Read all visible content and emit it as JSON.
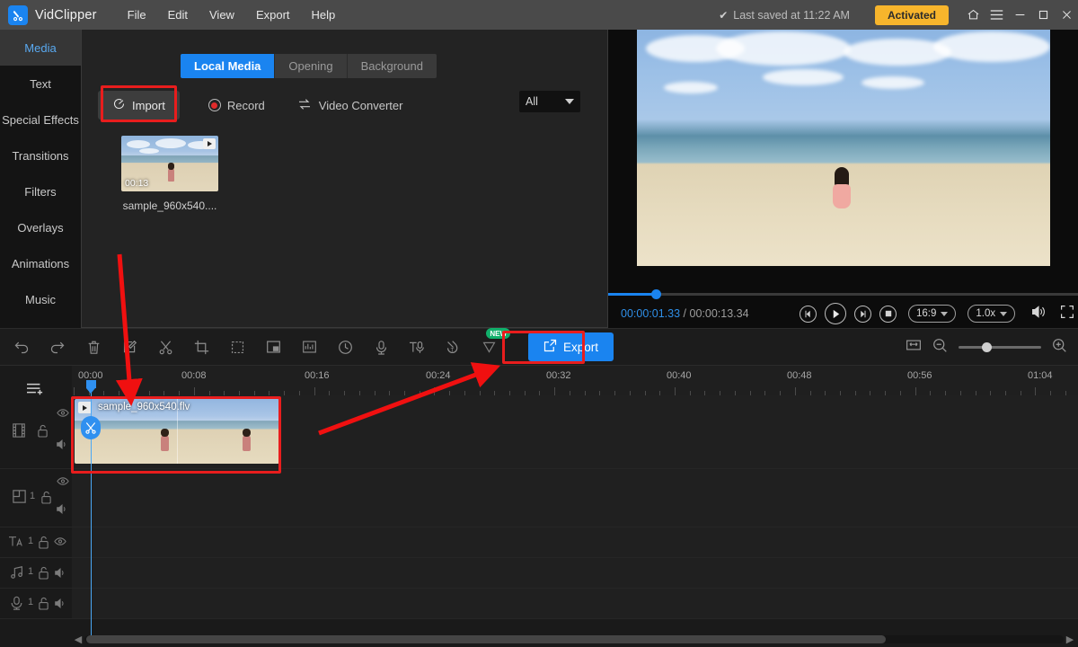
{
  "titlebar": {
    "app_name": "VidClipper",
    "logo_icon": "scissors-logo-icon",
    "menus": [
      "File",
      "Edit",
      "View",
      "Export",
      "Help"
    ],
    "saved_status": "Last saved at 11:22 AM",
    "check_icon": "check-icon",
    "license_badge": "Activated",
    "home_icon": "home-icon",
    "hamburger_icon": "hamburger-icon",
    "minimize_icon": "minimize-icon",
    "maximize_icon": "maximize-icon",
    "close_icon": "close-icon",
    "accent_color": "#1a84f0",
    "badge_color": "#f7b52c"
  },
  "sidebar": {
    "items": [
      {
        "label": "Media",
        "active": true
      },
      {
        "label": "Text",
        "active": false
      },
      {
        "label": "Special Effects",
        "active": false
      },
      {
        "label": "Transitions",
        "active": false
      },
      {
        "label": "Filters",
        "active": false
      },
      {
        "label": "Overlays",
        "active": false
      },
      {
        "label": "Animations",
        "active": false
      },
      {
        "label": "Music",
        "active": false
      }
    ]
  },
  "media_panel": {
    "tabs": [
      {
        "label": "Local Media",
        "active": true
      },
      {
        "label": "Opening",
        "active": false
      },
      {
        "label": "Background",
        "active": false
      }
    ],
    "import_label": "Import",
    "import_icon": "import-circle-arrow-icon",
    "record_label": "Record",
    "record_icon": "record-dot-icon",
    "converter_label": "Video Converter",
    "converter_icon": "convert-arrows-icon",
    "filter_value": "All",
    "filter_caret_icon": "chevron-down-icon",
    "assets": [
      {
        "name": "sample_960x540....",
        "duration": "00:13",
        "type_icon": "video-play-icon"
      }
    ]
  },
  "preview": {
    "current_time": "00:00:01.33",
    "separator": "/",
    "total_time": "00:00:13.34",
    "progress_percent": 10,
    "controls": [
      {
        "name": "previous-frame",
        "icon": "step-back-icon"
      },
      {
        "name": "play",
        "icon": "play-icon"
      },
      {
        "name": "next-frame",
        "icon": "step-forward-icon"
      },
      {
        "name": "stop",
        "icon": "stop-icon"
      }
    ],
    "aspect_ratio": "16:9",
    "playback_speed": "1.0x",
    "volume_icon": "speaker-icon",
    "fullscreen_icon": "fullscreen-icon"
  },
  "toolbar": {
    "icons": [
      {
        "name": "undo-icon",
        "glyph": "↶"
      },
      {
        "name": "redo-icon",
        "glyph": "↷"
      },
      {
        "name": "delete-icon",
        "glyph": "Ὕ1"
      },
      {
        "name": "edit-icon",
        "glyph": "✎"
      },
      {
        "name": "split-icon",
        "glyph": "✂"
      },
      {
        "name": "crop-icon",
        "glyph": "⌑"
      },
      {
        "name": "duplicate-icon",
        "glyph": "⧉"
      },
      {
        "name": "picture-in-picture-icon",
        "glyph": "▣"
      },
      {
        "name": "audio-waveform-icon",
        "glyph": "▐"
      },
      {
        "name": "speed-clock-icon",
        "glyph": "◴"
      },
      {
        "name": "microphone-icon",
        "glyph": "Ἲ4"
      },
      {
        "name": "text-to-speech-icon",
        "glyph": "T"
      },
      {
        "name": "watermark-icon",
        "glyph": "὘b"
      },
      {
        "name": "ai-tools-icon",
        "glyph": "✧",
        "badge": "NEW"
      }
    ],
    "export_label": "Export",
    "export_icon": "export-share-icon",
    "fit-timeline_icon": "fit-timeline-icon",
    "zoom_out_icon": "zoom-out-icon",
    "zoom_in_icon": "zoom-in-icon",
    "zoom_level_percent": 30
  },
  "timeline": {
    "add_track_icon": "add-track-icon",
    "ruler_labels": [
      "00:00",
      "00:08",
      "00:16",
      "00:24",
      "00:32",
      "00:40",
      "00:48",
      "00:56",
      "01:04"
    ],
    "playhead_time": "00:00:01.33",
    "scissors_icon": "scissors-icon",
    "tracks": [
      {
        "name": "video-track",
        "icon": "film-strip-icon",
        "count": "",
        "lock_icon": "unlock-icon",
        "eye_icon": "eye-icon",
        "audio_icon": "speaker-icon"
      },
      {
        "name": "pip-track",
        "icon": "pip-square-icon",
        "count": "1",
        "lock_icon": "unlock-icon",
        "eye_icon": "eye-icon",
        "audio_icon": "speaker-icon"
      },
      {
        "name": "text-track",
        "icon": "text-a-icon",
        "count": "1",
        "lock_icon": "unlock-icon",
        "eye_icon": "eye-icon",
        "audio_icon": ""
      },
      {
        "name": "music-track",
        "icon": "music-note-icon",
        "count": "1",
        "lock_icon": "unlock-icon",
        "eye_icon": "",
        "audio_icon": "speaker-icon"
      },
      {
        "name": "voiceover-track",
        "icon": "microphone-icon",
        "count": "1",
        "lock_icon": "unlock-icon",
        "eye_icon": "",
        "audio_icon": "speaker-icon"
      }
    ],
    "clip": {
      "title": "sample_960x540.flv",
      "type_icon": "video-play-icon"
    },
    "scroll_left_icon": "chevron-left-icon",
    "scroll_right_icon": "chevron-right-icon"
  },
  "annotations": {
    "color": "#e81d1d",
    "boxes": [
      {
        "name": "import-highlight"
      },
      {
        "name": "export-highlight"
      },
      {
        "name": "timeline-clip-highlight"
      }
    ],
    "arrows": [
      {
        "name": "arrow-to-timeline-clip"
      },
      {
        "name": "arrow-to-export-button"
      }
    ]
  }
}
